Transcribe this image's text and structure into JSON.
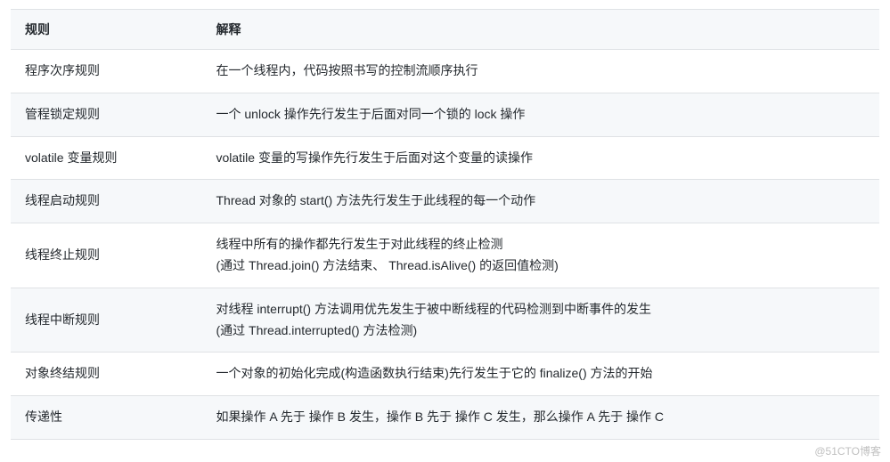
{
  "table": {
    "headers": {
      "rule": "规则",
      "explain": "解释"
    },
    "rows": [
      {
        "rule": "程序次序规则",
        "explain": "在一个线程内，代码按照书写的控制流顺序执行"
      },
      {
        "rule": "管程锁定规则",
        "explain": "一个 unlock 操作先行发生于后面对同一个锁的 lock 操作"
      },
      {
        "rule": "volatile 变量规则",
        "explain": "volatile 变量的写操作先行发生于后面对这个变量的读操作"
      },
      {
        "rule": "线程启动规则",
        "explain": "Thread 对象的 start() 方法先行发生于此线程的每一个动作"
      },
      {
        "rule": "线程终止规则",
        "explain": "线程中所有的操作都先行发生于对此线程的终止检测\n(通过 Thread.join() 方法结束、 Thread.isAlive() 的返回值检测)"
      },
      {
        "rule": "线程中断规则",
        "explain": "对线程 interrupt() 方法调用优先发生于被中断线程的代码检测到中断事件的发生\n(通过 Thread.interrupted() 方法检测)"
      },
      {
        "rule": "对象终结规则",
        "explain": "一个对象的初始化完成(构造函数执行结束)先行发生于它的 finalize() 方法的开始"
      },
      {
        "rule": "传递性",
        "explain": "如果操作 A 先于 操作 B 发生，操作 B 先于 操作 C 发生，那么操作 A 先于 操作 C"
      }
    ]
  },
  "watermark": "@51CTO博客"
}
